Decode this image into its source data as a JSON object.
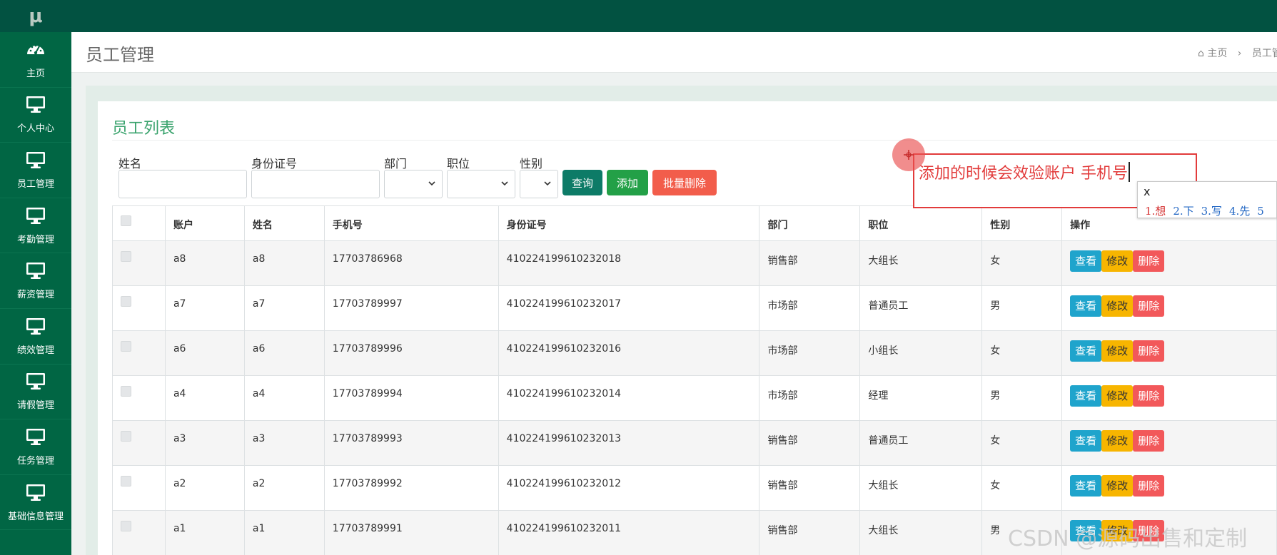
{
  "app": {
    "logo": "μ"
  },
  "sidebar": {
    "items": [
      {
        "icon": "dashboard-icon",
        "label": "主页"
      },
      {
        "icon": "monitor-icon",
        "label": "个人中心"
      },
      {
        "icon": "monitor-icon",
        "label": "员工管理"
      },
      {
        "icon": "monitor-icon",
        "label": "考勤管理"
      },
      {
        "icon": "monitor-icon",
        "label": "薪资管理"
      },
      {
        "icon": "monitor-icon",
        "label": "绩效管理"
      },
      {
        "icon": "monitor-icon",
        "label": "请假管理"
      },
      {
        "icon": "monitor-icon",
        "label": "任务管理"
      },
      {
        "icon": "monitor-icon",
        "label": "基础信息管理"
      }
    ]
  },
  "header": {
    "title": "员工管理",
    "breadcrumb": {
      "home_icon": "home-icon",
      "home": "主页",
      "sep": "›",
      "current": "员工管"
    }
  },
  "card": {
    "title": "员工列表"
  },
  "filters": {
    "name_label": "姓名",
    "idcard_label": "身份证号",
    "dept_label": "部门",
    "position_label": "职位",
    "gender_label": "性别",
    "name_value": "",
    "idcard_value": "",
    "dept_value": "",
    "position_value": "",
    "gender_value": ""
  },
  "buttons": {
    "query": "查询",
    "add": "添加",
    "batch_delete": "批量删除"
  },
  "colors": {
    "query": "#0d7b67",
    "add": "#23a047",
    "batch_delete": "#f25d4b",
    "sidebar": "#016644",
    "topbar": "#025241"
  },
  "table": {
    "headers": [
      "",
      "账户",
      "姓名",
      "手机号",
      "身份证号",
      "部门",
      "职位",
      "性别",
      "操作"
    ],
    "actions": {
      "view": "查看",
      "edit": "修改",
      "delete": "删除"
    },
    "rows": [
      {
        "account": "a8",
        "name": "a8",
        "phone": "17703786968",
        "idcard": "410224199610232018",
        "dept": "销售部",
        "position": "大组长",
        "gender": "女"
      },
      {
        "account": "a7",
        "name": "a7",
        "phone": "17703789997",
        "idcard": "410224199610232017",
        "dept": "市场部",
        "position": "普通员工",
        "gender": "男"
      },
      {
        "account": "a6",
        "name": "a6",
        "phone": "17703789996",
        "idcard": "410224199610232016",
        "dept": "市场部",
        "position": "小组长",
        "gender": "女"
      },
      {
        "account": "a4",
        "name": "a4",
        "phone": "17703789994",
        "idcard": "410224199610232014",
        "dept": "市场部",
        "position": "经理",
        "gender": "男"
      },
      {
        "account": "a3",
        "name": "a3",
        "phone": "17703789993",
        "idcard": "410224199610232013",
        "dept": "销售部",
        "position": "普通员工",
        "gender": "女"
      },
      {
        "account": "a2",
        "name": "a2",
        "phone": "17703789992",
        "idcard": "410224199610232012",
        "dept": "销售部",
        "position": "大组长",
        "gender": "女"
      },
      {
        "account": "a1",
        "name": "a1",
        "phone": "17703789991",
        "idcard": "410224199610232011",
        "dept": "销售部",
        "position": "大组长",
        "gender": "男"
      }
    ]
  },
  "annotation": {
    "text": "添加的时候会效验账户 手机号",
    "ime_input": "x",
    "ime_candidates": [
      "1.想",
      "2.下",
      "3.写",
      "4.先",
      "5"
    ]
  },
  "watermark": "CSDN @源码出售和定制"
}
